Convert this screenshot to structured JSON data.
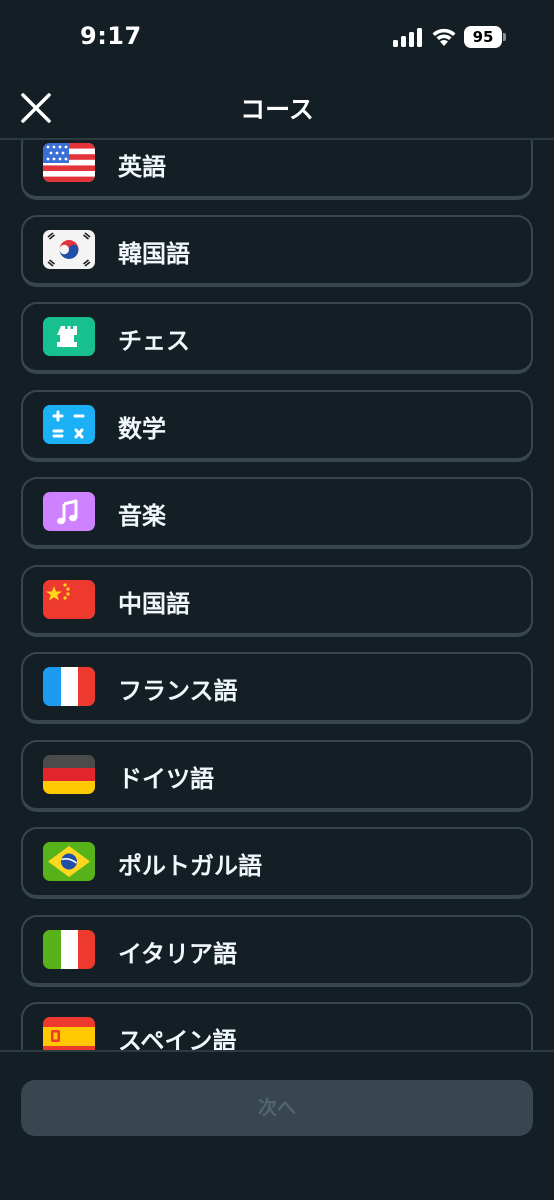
{
  "status_bar": {
    "time": "9:17",
    "battery": "95"
  },
  "header": {
    "title": "コース"
  },
  "courses": [
    {
      "label": "英語",
      "flag": "usa-flag-icon"
    },
    {
      "label": "韓国語",
      "flag": "korea-flag-icon"
    },
    {
      "label": "チェス",
      "flag": "chess-rook-icon"
    },
    {
      "label": "数学",
      "flag": "math-operators-icon"
    },
    {
      "label": "音楽",
      "flag": "music-note-icon"
    },
    {
      "label": "中国語",
      "flag": "china-flag-icon"
    },
    {
      "label": "フランス語",
      "flag": "france-flag-icon"
    },
    {
      "label": "ドイツ語",
      "flag": "germany-flag-icon"
    },
    {
      "label": "ポルトガル語",
      "flag": "brazil-flag-icon"
    },
    {
      "label": "イタリア語",
      "flag": "italy-flag-icon"
    },
    {
      "label": "スペイン語",
      "flag": "spain-flag-icon"
    }
  ],
  "footer": {
    "next_label": "次へ"
  },
  "colors": {
    "background": "#131f24",
    "card_border": "#37464f",
    "button_disabled_bg": "#37464f",
    "button_disabled_text": "#52656d",
    "chess_green": "#18c08f",
    "math_blue": "#1cb0f6",
    "music_purple": "#ce82ff"
  }
}
